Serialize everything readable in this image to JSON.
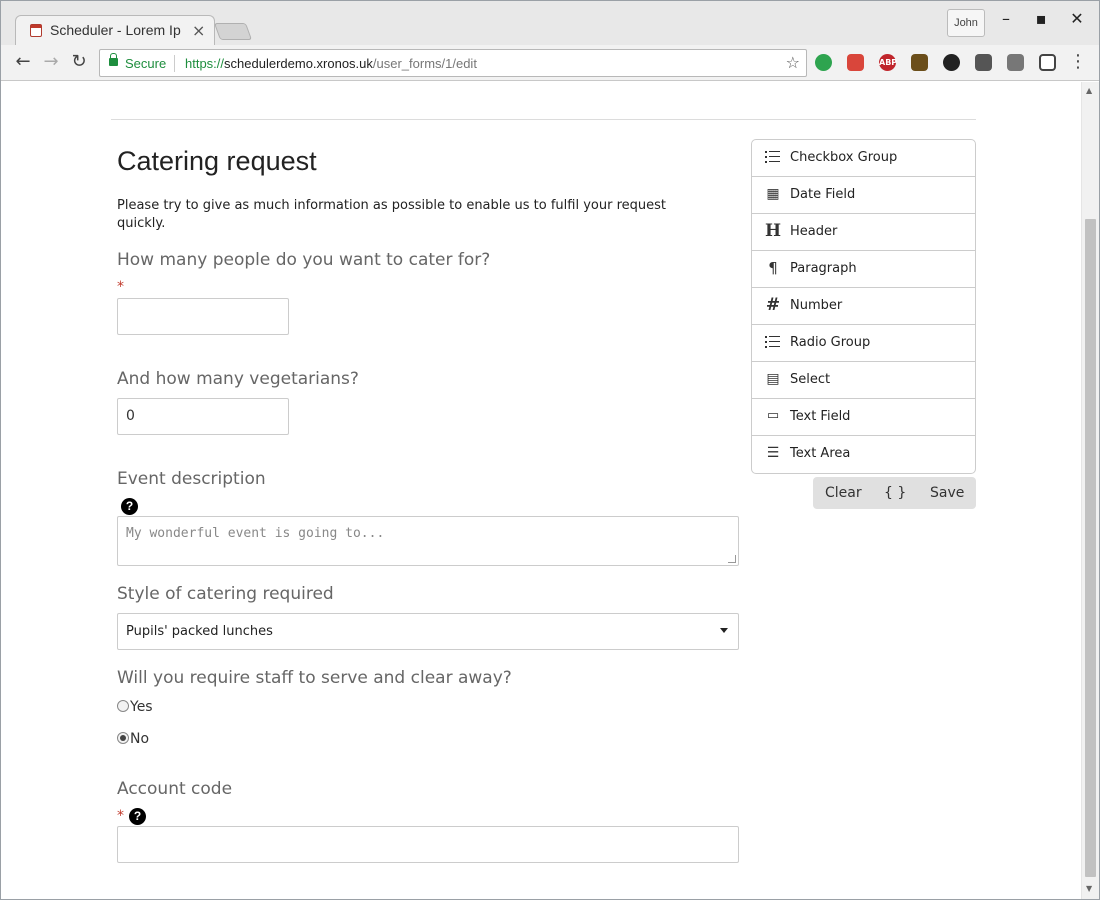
{
  "browser": {
    "tab_title": "Scheduler - Lorem Ip",
    "profile_name": "John",
    "secure_label": "Secure",
    "url_scheme": "https://",
    "url_host": "schedulerdemo.xronos.uk",
    "url_path": "/user_forms/1/edit"
  },
  "form": {
    "title": "Catering request",
    "description": "Please try to give as much information as possible to enable us to fulfil your request quickly.",
    "required_mark": "*",
    "help_mark": "?",
    "fields": {
      "people": {
        "label": "How many people do you want to cater for?",
        "value": ""
      },
      "vegetarians": {
        "label": "And how many vegetarians?",
        "value": "0"
      },
      "event": {
        "label": "Event description",
        "placeholder": "My wonderful event is going to..."
      },
      "style": {
        "label": "Style of catering required",
        "selected": "Pupils' packed lunches"
      },
      "staff": {
        "label": "Will you require staff to serve and clear away?",
        "options": [
          "Yes",
          "No"
        ],
        "selected": "No"
      },
      "account": {
        "label": "Account code",
        "value": ""
      }
    }
  },
  "palette": {
    "items": [
      {
        "label": "Checkbox Group",
        "icon": "checkbox-group-icon"
      },
      {
        "label": "Date Field",
        "icon": "calendar-icon"
      },
      {
        "label": "Header",
        "icon": "header-icon"
      },
      {
        "label": "Paragraph",
        "icon": "paragraph-icon"
      },
      {
        "label": "Number",
        "icon": "hash-icon"
      },
      {
        "label": "Radio Group",
        "icon": "radio-group-icon"
      },
      {
        "label": "Select",
        "icon": "select-icon"
      },
      {
        "label": "Text Field",
        "icon": "text-field-icon"
      },
      {
        "label": "Text Area",
        "icon": "text-area-icon"
      }
    ],
    "actions": {
      "clear": "Clear",
      "json": "{ }",
      "save": "Save"
    }
  }
}
